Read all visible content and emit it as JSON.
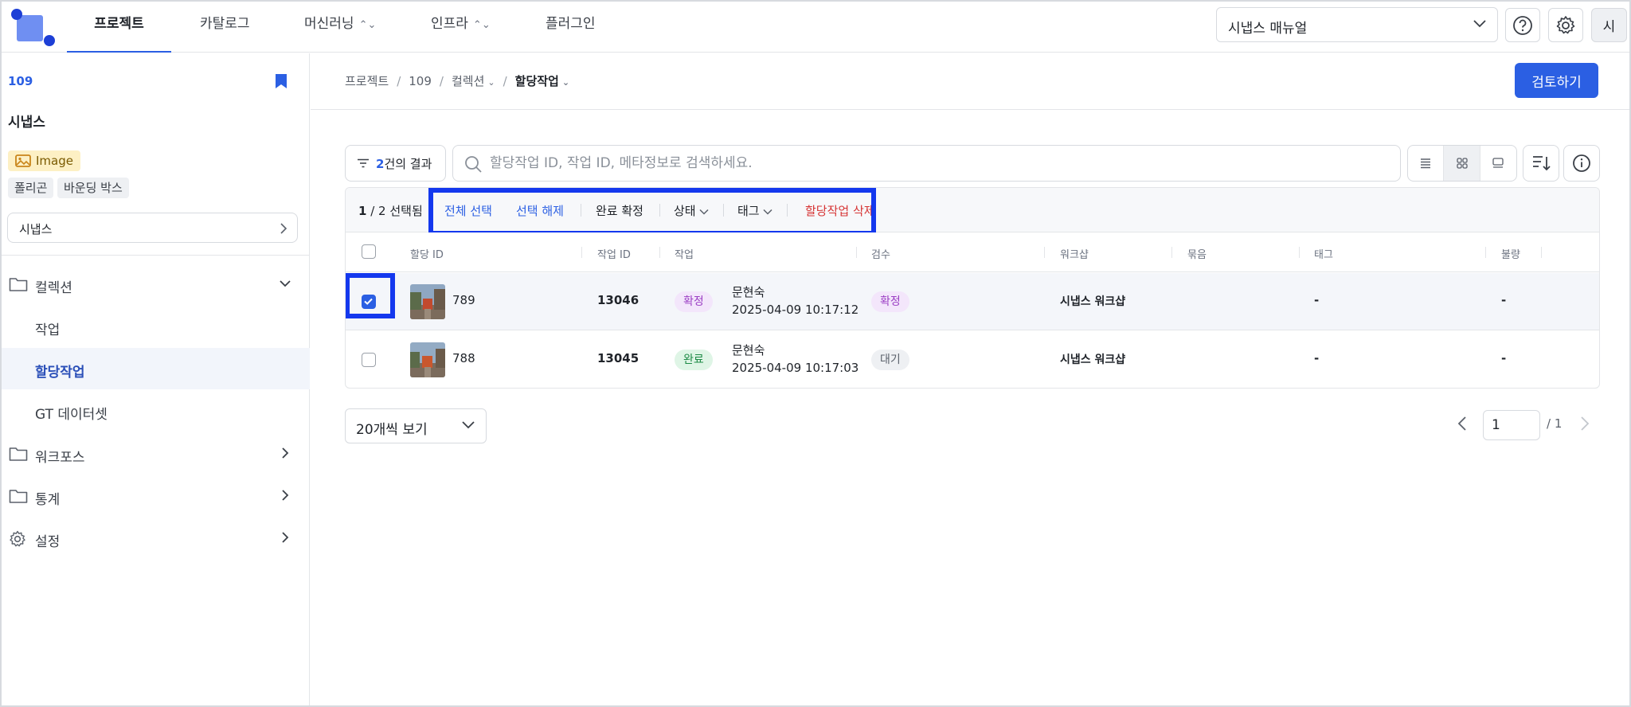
{
  "nav": {
    "tabs": [
      {
        "label": "프로젝트",
        "active": true
      },
      {
        "label": "카탈로그"
      },
      {
        "label": "머신러닝",
        "has_submenu": true
      },
      {
        "label": "인프라",
        "has_submenu": true
      },
      {
        "label": "플러그인"
      }
    ],
    "doc_select": "시냅스 매뉴얼",
    "help_icon": "question-circle-icon",
    "settings_icon": "gear-icon",
    "avatar": "시"
  },
  "sidebar": {
    "project_id": "109",
    "project_name": "시냅스",
    "data_type": "Image",
    "annotation_tools": [
      "폴리곤",
      "바운딩 박스"
    ],
    "workspace_select": "시냅스",
    "menu": {
      "collection": {
        "label": "컬렉션",
        "expanded": true
      },
      "collection_items": [
        {
          "label": "작업"
        },
        {
          "label": "할당작업",
          "active": true
        },
        {
          "label": "GT 데이터셋"
        }
      ],
      "workforce": {
        "label": "워크포스"
      },
      "stats": {
        "label": "통계"
      },
      "settings": {
        "label": "설정"
      }
    }
  },
  "breadcrumb": {
    "items": [
      "프로젝트",
      "109",
      "컬렉션"
    ],
    "current": "할당작업"
  },
  "review_button": "검토하기",
  "toolbar": {
    "result_count": "2",
    "result_suffix": "건의 결과",
    "search_placeholder": "할당작업 ID, 작업 ID, 메타정보로 검색하세요."
  },
  "bulk": {
    "selected": "1",
    "total": "/ 2",
    "selected_suffix": "선택됨",
    "select_all": "전체 선택",
    "deselect": "선택 해제",
    "confirm": "완료 확정",
    "status": "상태",
    "tag": "태그",
    "delete": "할당작업 삭제"
  },
  "table": {
    "columns": [
      "할당 ID",
      "작업 ID",
      "작업",
      "검수",
      "워크샵",
      "묶음",
      "태그",
      "불량"
    ],
    "rows": [
      {
        "selected": true,
        "assignment_id": "789",
        "task_id": "13046",
        "work_status": "확정",
        "worker": "문현숙",
        "time": "2025-04-09 10:17:12",
        "review_status": "확정",
        "workshop": "시냅스 워크샵",
        "tag": "-",
        "defect": "-"
      },
      {
        "selected": false,
        "assignment_id": "788",
        "task_id": "13045",
        "work_status": "완료",
        "worker": "문현숙",
        "time": "2025-04-09 10:17:03",
        "review_status": "대기",
        "workshop": "시냅스 워크샵",
        "tag": "-",
        "defect": "-"
      }
    ]
  },
  "pagination": {
    "per_page": "20개씩 보기",
    "current_page": "1",
    "total_pages": "/ 1"
  },
  "colors": {
    "primary": "#2b5fe3",
    "highlight": "#1438ee",
    "danger": "#d63535"
  }
}
